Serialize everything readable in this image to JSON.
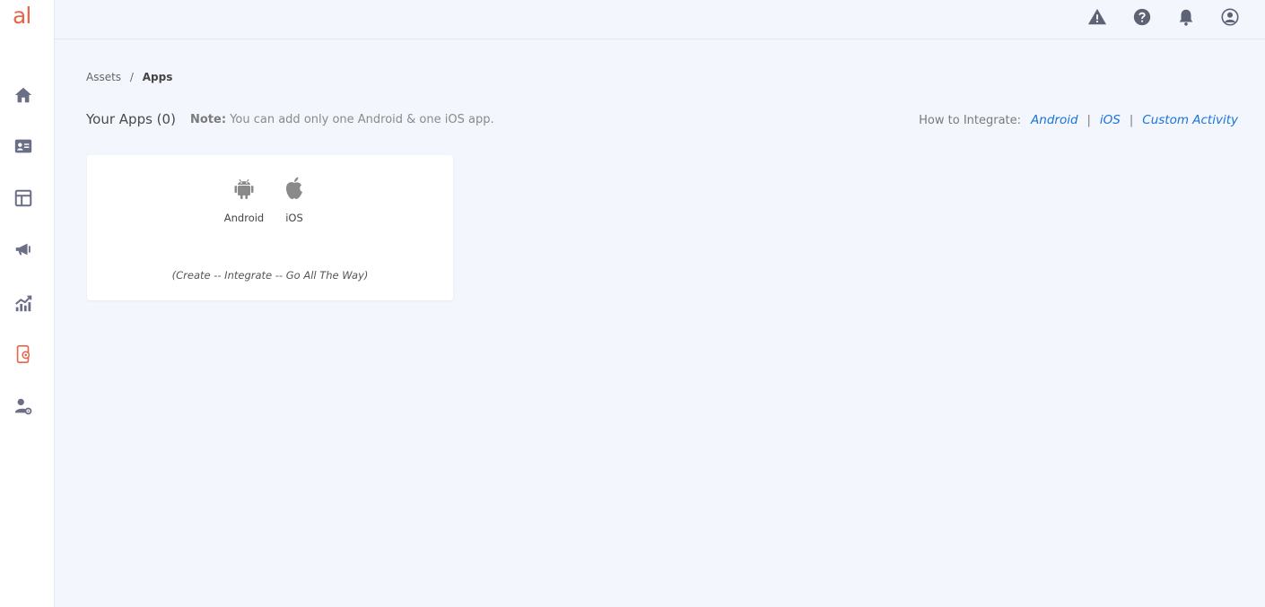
{
  "app": {
    "logo_text": "al",
    "brand_color": "#e8654a"
  },
  "sidebar": {
    "items": [
      {
        "name": "home",
        "icon": "home-icon"
      },
      {
        "name": "contacts",
        "icon": "id-card-icon"
      },
      {
        "name": "layout",
        "icon": "layout-icon"
      },
      {
        "name": "campaigns",
        "icon": "megaphone-icon"
      },
      {
        "name": "analytics",
        "icon": "chart-icon"
      },
      {
        "name": "assets",
        "icon": "mobile-app-icon",
        "active": true
      },
      {
        "name": "user-settings",
        "icon": "user-gear-icon"
      }
    ],
    "icon_color": "#6b6f86",
    "active_color": "#e8654a"
  },
  "topbar": {
    "icons": [
      "alert-icon",
      "help-icon",
      "bell-icon",
      "user-icon"
    ]
  },
  "breadcrumb": {
    "parent": "Assets",
    "separator": "/",
    "current": "Apps"
  },
  "main": {
    "title": "Your Apps (0)",
    "note_label": "Note:",
    "note_text": "You can add only one Android & one iOS app.",
    "integrate_label": "How to Integrate:",
    "integrate_links": [
      "Android",
      "iOS",
      "Custom Activity"
    ],
    "link_color": "#1a73d9"
  },
  "card": {
    "platforms": [
      {
        "label": "Android",
        "icon": "android-icon"
      },
      {
        "label": "iOS",
        "icon": "apple-icon"
      }
    ],
    "tagline": "(Create -- Integrate -- Go All The Way)"
  }
}
